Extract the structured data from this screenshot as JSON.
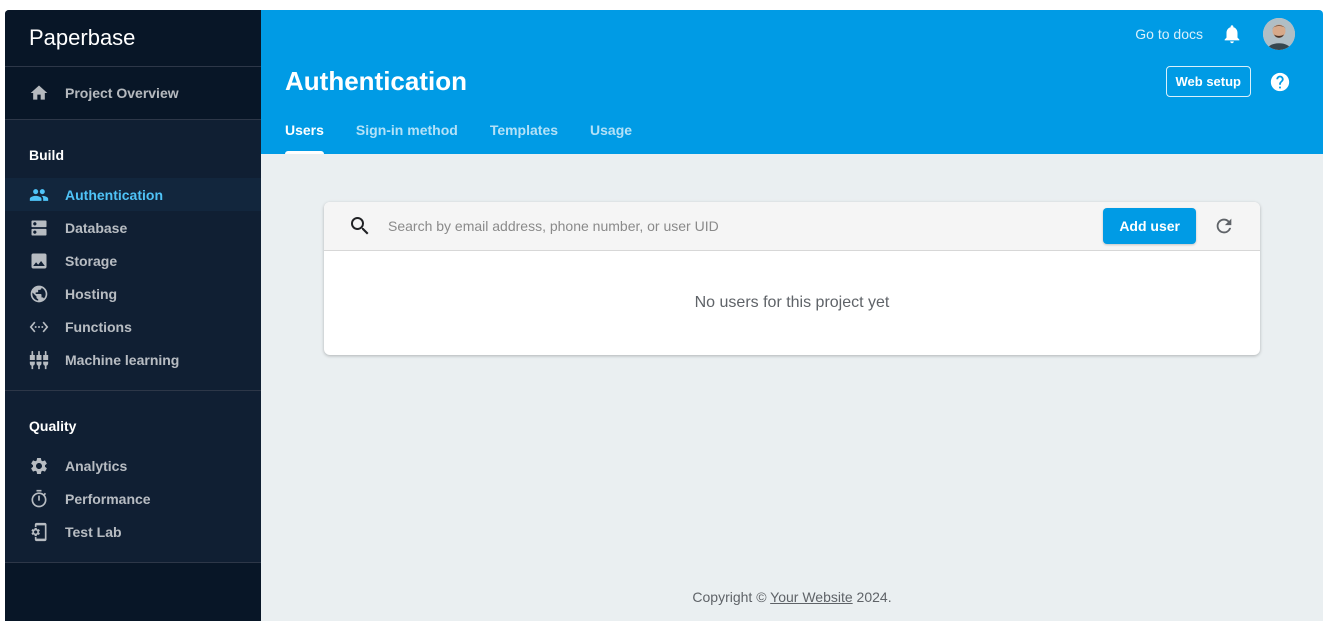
{
  "sidebar": {
    "brand": "Paperbase",
    "overview": {
      "label": "Project Overview",
      "icon": "home-icon"
    },
    "sections": [
      {
        "title": "Build",
        "items": [
          {
            "label": "Authentication",
            "icon": "people-icon",
            "active": true
          },
          {
            "label": "Database",
            "icon": "dns-icon"
          },
          {
            "label": "Storage",
            "icon": "image-icon"
          },
          {
            "label": "Hosting",
            "icon": "public-icon"
          },
          {
            "label": "Functions",
            "icon": "settings-ethernet-icon"
          },
          {
            "label": "Machine learning",
            "icon": "settings-input-component-icon"
          }
        ]
      },
      {
        "title": "Quality",
        "items": [
          {
            "label": "Analytics",
            "icon": "settings-icon"
          },
          {
            "label": "Performance",
            "icon": "timer-icon"
          },
          {
            "label": "Test Lab",
            "icon": "phonelink-setup-icon"
          }
        ]
      }
    ]
  },
  "header": {
    "docs_link": "Go to docs",
    "title": "Authentication",
    "web_setup": "Web setup",
    "tabs": [
      "Users",
      "Sign-in method",
      "Templates",
      "Usage"
    ],
    "active_tab": 0
  },
  "search": {
    "placeholder": "Search by email address, phone number, or user UID",
    "add_user": "Add user"
  },
  "empty_message": "No users for this project yet",
  "footer": {
    "prefix": "Copyright © ",
    "link": "Your Website",
    "suffix": " 2024."
  },
  "colors": {
    "header": "#009be5",
    "sidebar": "#101f33",
    "sidebar_dark": "#081627",
    "active": "#4fc3f7",
    "content_bg": "#eaeff1"
  }
}
